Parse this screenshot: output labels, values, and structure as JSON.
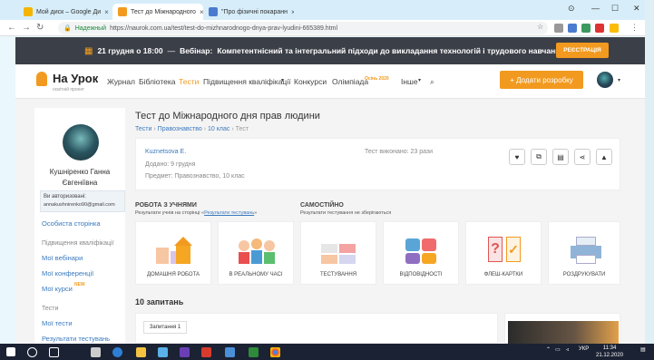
{
  "browser": {
    "tabs": [
      {
        "title": "Мой диск – Google Ди",
        "favicon_color": "#f4b400"
      },
      {
        "title": "Тест до Міжнародного",
        "favicon_color": "#f29a1f"
      },
      {
        "title": "\"Про фізичні покаранн",
        "favicon_color": "#4a7bd0"
      }
    ],
    "secure_label": "Надежный",
    "url": "https://naurok.com.ua/test/test-do-mizhnarodnogo-dnya-prav-lyudini-665389.html",
    "window_controls": [
      "—",
      "☐",
      "✕"
    ]
  },
  "banner": {
    "date": "21 грудня о 18:00",
    "dash": "—",
    "label": "Вебінар:",
    "text": "Компетентнісний та інтегральний підходи до викладання технологій і трудового навчання",
    "button": "РЕЄСТРАЦІЯ"
  },
  "header": {
    "logo_name": "На Урок",
    "logo_sub": "освітній проект",
    "menu": [
      "Журнал",
      "Бібліотека",
      "Тести",
      "Підвищення кваліфікації",
      "Конкурси",
      "Олімпіада",
      "Інше"
    ],
    "olympiad_badge": "Осінь 2020",
    "add_button": "+ Додати розробку",
    "accent": "#f29a1f"
  },
  "sidebar": {
    "user_name": "Кушніренко Ганна Євгеніївна",
    "auth_label": "Ви авторизовані:",
    "auth_email": "annakushnirenko90@gmail.com",
    "personal_page": "Особиста сторінка",
    "qual_heading": "Підвищення кваліфікації",
    "qual_links": [
      "Мої вебінари",
      "Мої конференції",
      "Мої курси"
    ],
    "new_badge": "NEW",
    "tests_heading": "Тести",
    "tests_links": [
      "Мої тести",
      "Результати тестувань"
    ]
  },
  "main": {
    "title": "Тест до Міжнародного дня прав людини",
    "breadcrumb": [
      "Тести",
      "Правознавство",
      "10 клас",
      "Тест"
    ],
    "breadcrumb_sep": "›",
    "author": "Kuznetsova E.",
    "added": "Додано: 9 грудня",
    "subject": "Предмет: Правознавство, 10 клас",
    "completed": "Тест виконано: 23 рази",
    "section1_title": "РОБОТА З УЧНЯМИ",
    "section1_sub_prefix": "Результати учнів на сторінці «",
    "section1_sub_link": "Результати тестувань",
    "section1_sub_suffix": "»",
    "section2_title": "САМОСТІЙНО",
    "section2_sub": "Результати тестування не зберігаються",
    "cards": [
      "ДОМАШНЯ РОБОТА",
      "В РЕАЛЬНОМУ ЧАСІ",
      "ТЕСТУВАННЯ",
      "ВІДПОВІДНОСТІ",
      "ФЛЕШ-КАРТКИ",
      "РОЗДРУКУВАТИ"
    ],
    "questions_heading": "10 запитань",
    "question_tab": "Запитання 1"
  },
  "taskbar": {
    "lang": "УКР",
    "time": "11:34",
    "date": "21.12.2020"
  }
}
